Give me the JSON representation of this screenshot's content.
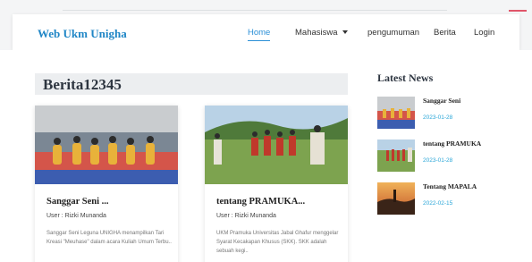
{
  "navbar": {
    "brand": "Web Ukm Unigha",
    "items": [
      {
        "label": "Home",
        "active": true
      },
      {
        "label": "Mahasiswa",
        "dropdown": true
      },
      {
        "label": "pengumuman"
      },
      {
        "label": "Berita"
      },
      {
        "label": "Login"
      }
    ]
  },
  "page": {
    "title": "Berita12345"
  },
  "cards": [
    {
      "title": "Sanggar Seni ...",
      "user": "User : Rizki Munanda",
      "excerpt": "Sanggar Seni Leguna UNIGHA menampilkan Tari Kreasi \"Meuhase\" dalam acara Kuliah Umum Terbu..",
      "image_icon": "dance-photo"
    },
    {
      "title": "tentang PRAMUKA...",
      "user": "User : Rizki Munanda",
      "excerpt": "UKM Pramuka Universitas Jabal Ghafur menggelar Syarat Kecakapan Khusus (SKK). SKK adalah sebuah kegi..",
      "image_icon": "scout-photo"
    }
  ],
  "sidebar": {
    "title": "Latest News",
    "items": [
      {
        "title": "Sanggar Seni",
        "date": "2023-01-28",
        "image_icon": "dance-thumb"
      },
      {
        "title": "tentang PRAMUKA",
        "date": "2023-01-28",
        "image_icon": "scout-thumb"
      },
      {
        "title": "Tentang MAPALA",
        "date": "2022-02-15",
        "image_icon": "sunset-thumb"
      }
    ]
  },
  "colors": {
    "brand": "#1f86c6",
    "active_nav": "#2b8fd6",
    "date": "#2aa6d8"
  }
}
